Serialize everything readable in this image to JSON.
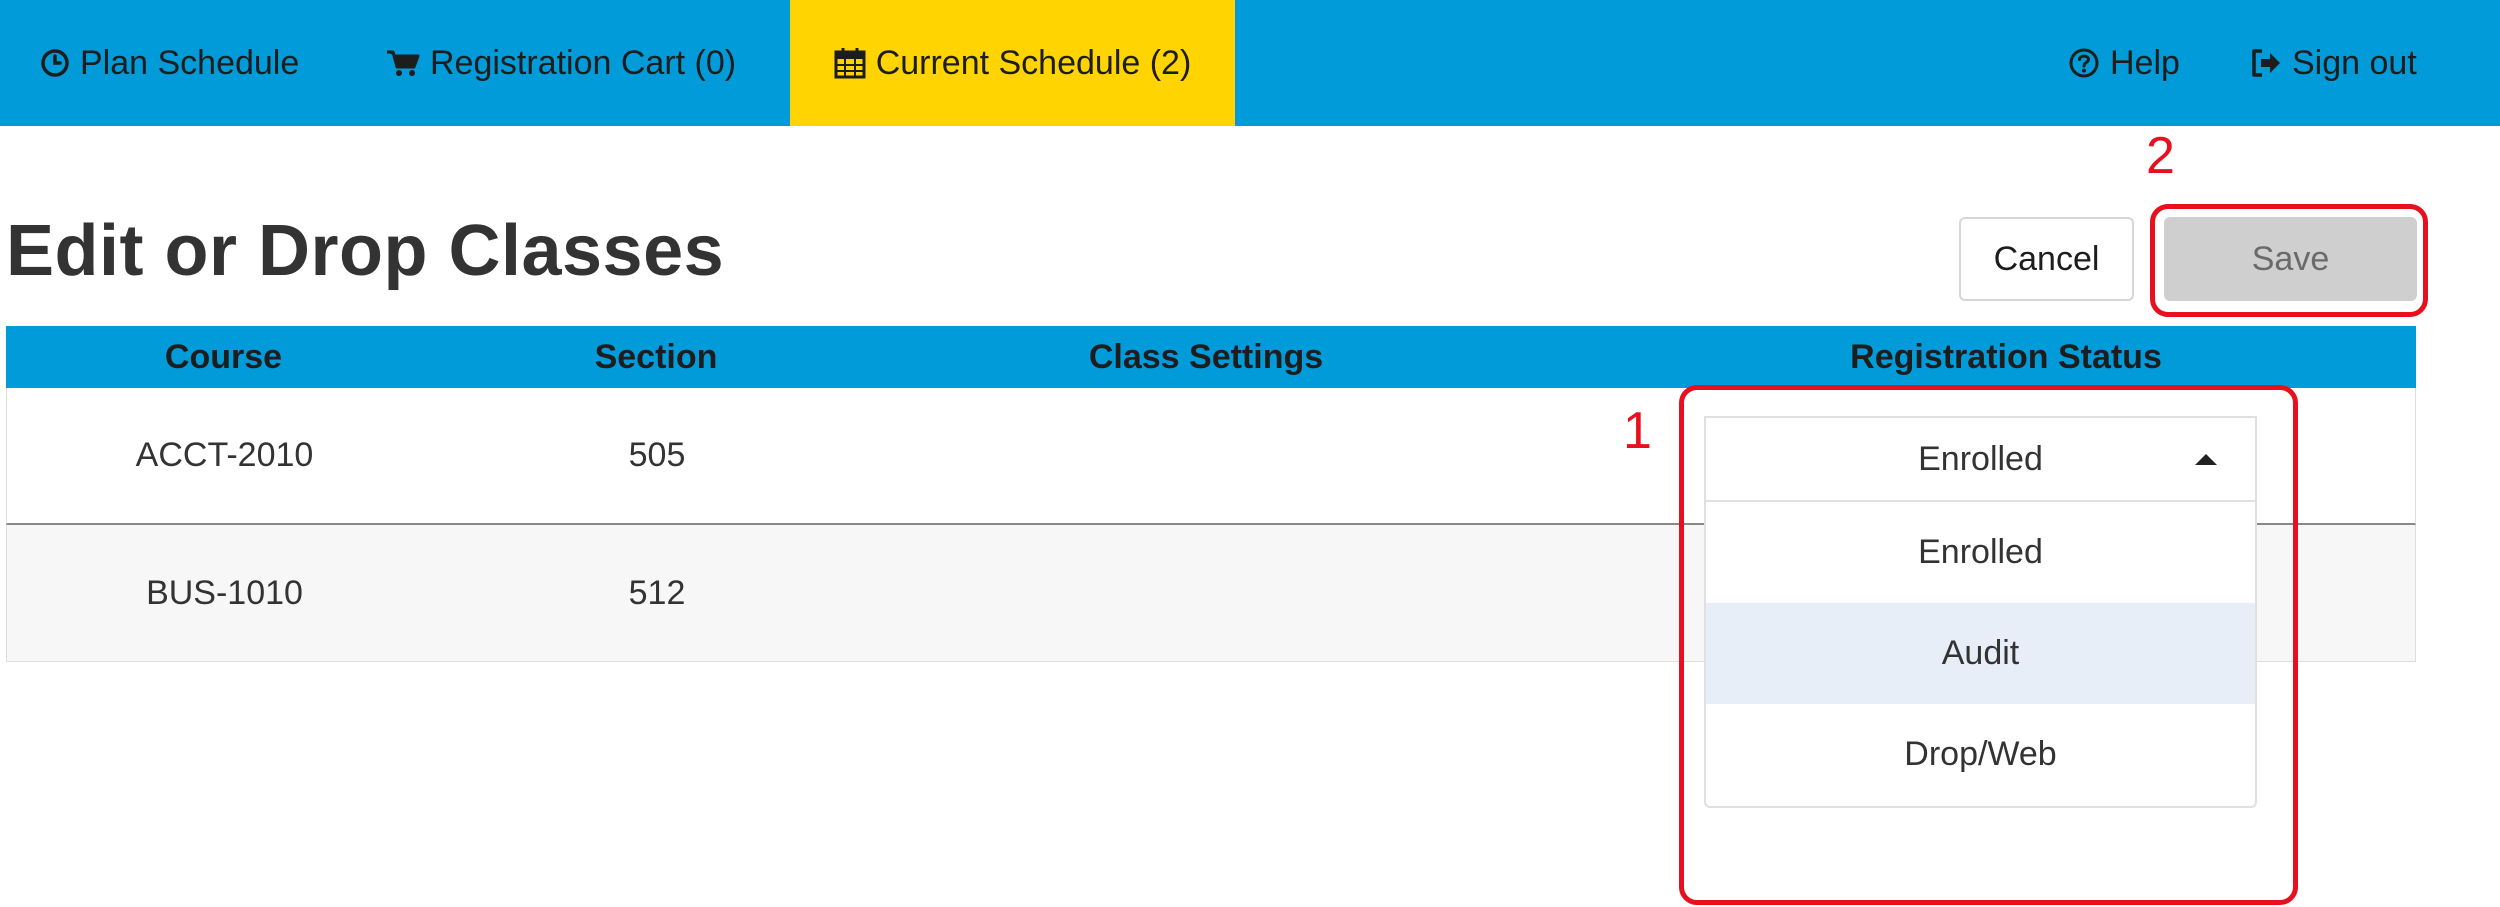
{
  "nav": {
    "plan_schedule": {
      "label": "Plan Schedule",
      "icon": "clock-icon"
    },
    "registration_cart": {
      "label": "Registration Cart (0)",
      "icon": "cart-icon"
    },
    "current_schedule": {
      "label": "Current Schedule (2)",
      "icon": "calendar-icon",
      "active": true
    },
    "help": {
      "label": "Help",
      "icon": "question-circle-icon"
    },
    "sign_out": {
      "label": "Sign out",
      "icon": "sign-out-icon"
    }
  },
  "page": {
    "title": "Edit or Drop Classes",
    "cancel_label": "Cancel",
    "save_label": "Save"
  },
  "table": {
    "columns": [
      "Course",
      "Section",
      "Class Settings",
      "Registration Status"
    ],
    "rows": [
      {
        "course": "ACCT-2010",
        "section": "505",
        "class_settings": "",
        "status": "Enrolled"
      },
      {
        "course": "BUS-1010",
        "section": "512",
        "class_settings": "",
        "status": ""
      }
    ]
  },
  "status_dropdown": {
    "selected": "Enrolled",
    "options": [
      "Enrolled",
      "Audit",
      "Drop/Web"
    ],
    "highlighted": "Audit"
  },
  "annotations": {
    "callout_1": "1",
    "callout_2": "2"
  },
  "colors": {
    "nav_bg": "#009bd8",
    "nav_active": "#ffd400",
    "table_header_bg": "#009bd8",
    "save_disabled": "#cfcfcf",
    "callout_red": "#e8101e",
    "option_highlight": "#e8eef8"
  }
}
